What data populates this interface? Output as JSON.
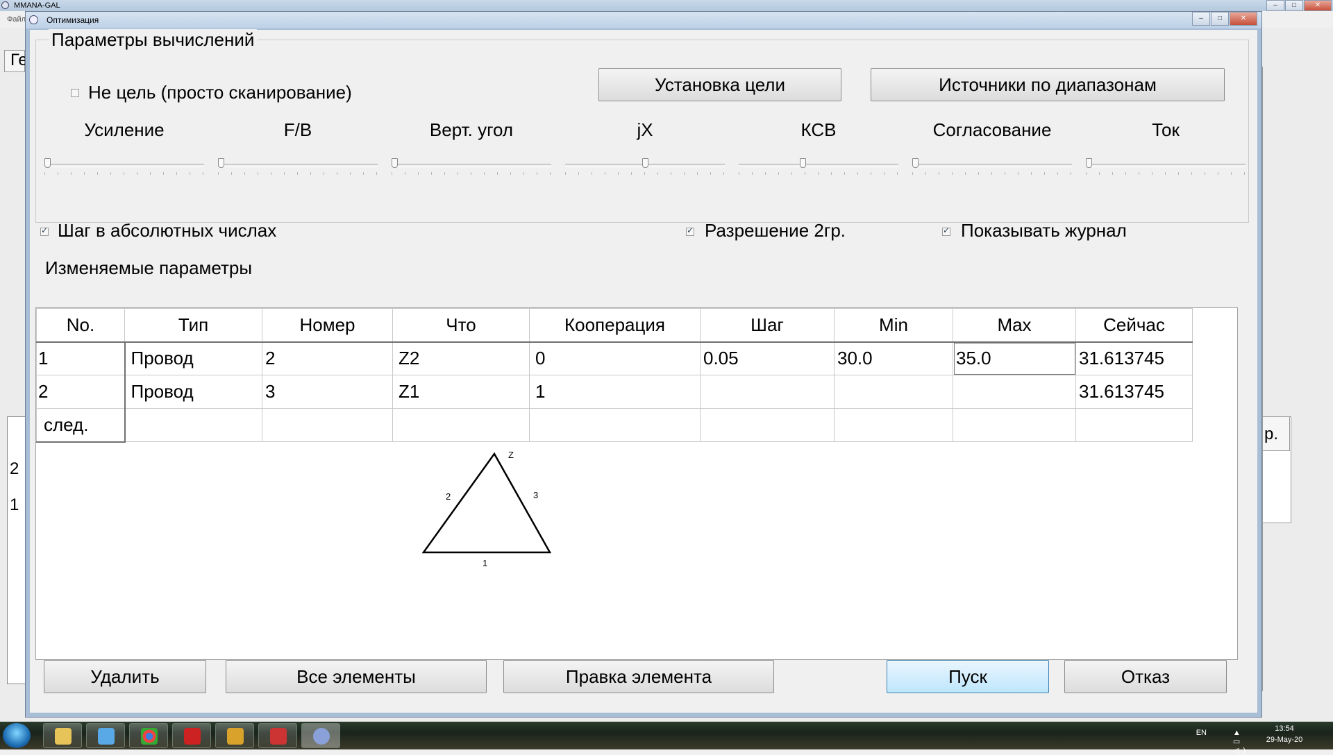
{
  "app": {
    "title": "MMANA-GAL",
    "menu_hint": "Файл",
    "tab_fragment": "Ге",
    "left_numbers": [
      "2",
      "1"
    ],
    "right_header_fragment": "р."
  },
  "dialog": {
    "title": "Оптимизация",
    "group_label": "Параметры вычислений",
    "no_goal_label": "Не цель (просто сканирование)",
    "set_goal_button": "Установка цели",
    "band_sources_button": "Источники по диапазонам",
    "sliders": [
      {
        "label": "Усиление",
        "value": 0.0
      },
      {
        "label": "F/B",
        "value": 0.0
      },
      {
        "label": "Верт. угол",
        "value": 0.0
      },
      {
        "label": "jX",
        "value": 0.5
      },
      {
        "label": "КСВ",
        "value": 0.4
      },
      {
        "label": "Согласование",
        "value": 0.0
      },
      {
        "label": "Ток",
        "value": 0.0
      }
    ],
    "abs_step_label": "Шаг в абсолютных числах",
    "resolution_label": "Разрешение 2гр.",
    "show_log_label": "Показывать журнал",
    "params_title": "Изменяемые параметры",
    "table": {
      "headers": [
        "No.",
        "Тип",
        "Номер",
        "Что",
        "Кооперация",
        "Шаг",
        "Min",
        "Max",
        "Сейчас"
      ],
      "rows": [
        [
          "1",
          "Провод",
          "2",
          "Z2",
          "0",
          "0.05",
          "30.0",
          "35.0",
          "31.613745"
        ],
        [
          "2",
          "Провод",
          "3",
          "Z1",
          "1",
          "",
          "",
          "",
          "31.613745"
        ],
        [
          "след.",
          "",
          "",
          "",
          "",
          "",
          "",
          "",
          ""
        ]
      ]
    },
    "diagram": {
      "label_top": "Z",
      "label_left": "2",
      "label_right": "3",
      "label_bottom": "1"
    },
    "buttons": {
      "delete": "Удалить",
      "all_elements": "Все элементы",
      "edit_element": "Правка элемента",
      "start": "Пуск",
      "cancel": "Отказ"
    }
  },
  "taskbar": {
    "lang": "EN",
    "time": "13:54",
    "date": "29-May-20"
  },
  "colors": {
    "dialog_frame": "#a8bdd6",
    "primary_button": "#bee6fd"
  }
}
